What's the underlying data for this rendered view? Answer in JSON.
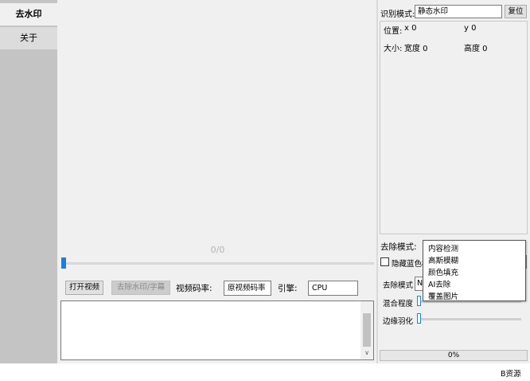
{
  "sidebar": {
    "items": [
      {
        "label": "去水印",
        "active": true
      },
      {
        "label": "关于",
        "active": false
      }
    ]
  },
  "preview": {
    "frame_counter": "0/0"
  },
  "controls": {
    "open_video": "打开视频",
    "remove_watermark": "去除水印/字幕",
    "bitrate_label": "视频码率:",
    "bitrate_value": "原视频码率",
    "engine_label": "引擎:",
    "engine_value": "CPU"
  },
  "detect": {
    "mode_label": "识别模式:",
    "mode_value": "静态水印",
    "reset_button": "复位",
    "position_label": "位置:",
    "x_label": "x 0",
    "y_label": "y 0",
    "size_label": "大小:",
    "width_label": "宽度 0",
    "height_label": "高度 0"
  },
  "removal": {
    "mode_label": "去除模式:",
    "options": [
      "内容检测",
      "高斯模糊",
      "颜色填充",
      "AI去除",
      "覆盖图片"
    ],
    "hide_blue_label": "隐藏蓝色框",
    "sub_mode_label": "去除模式",
    "sub_mode_value": "N",
    "blend_label": "混合程度",
    "blend_value": 0,
    "feather_label": "边缘羽化",
    "feather_value": 0
  },
  "progress": {
    "text": "0%",
    "value": 0
  },
  "footer": {
    "text": "B资源"
  },
  "colors": {
    "accent": "#1e7fd6",
    "sidebar_bg": "#c4c4c4",
    "window_bg": "#f0f0f0"
  }
}
